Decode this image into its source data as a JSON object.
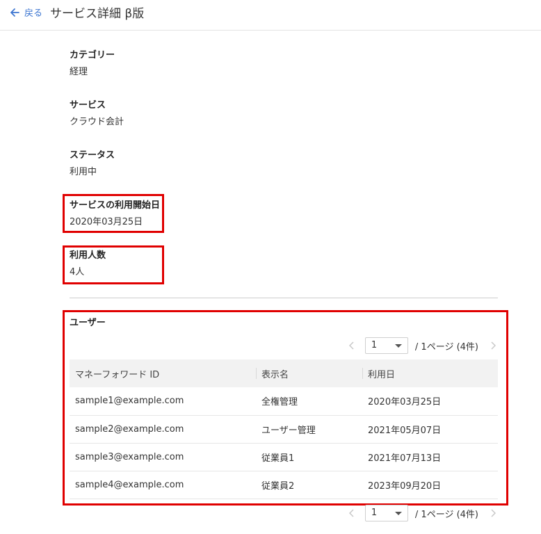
{
  "header": {
    "back_label": "戻る",
    "title": "サービス詳細 β版"
  },
  "fields": [
    {
      "label": "カテゴリー",
      "value": "経理"
    },
    {
      "label": "サービス",
      "value": "クラウド会計"
    },
    {
      "label": "ステータス",
      "value": "利用中"
    },
    {
      "label": "サービスの利用開始日",
      "value": "2020年03月25日"
    },
    {
      "label": "利用人数",
      "value": "4人"
    }
  ],
  "users_section": {
    "title": "ユーザー",
    "pager": {
      "current_page": "1",
      "summary": "/ 1ページ (4件)"
    },
    "columns": [
      "マネーフォワード ID",
      "表示名",
      "利用日"
    ],
    "rows": [
      [
        "sample1@example.com",
        "全権管理",
        "2020年03月25日"
      ],
      [
        "sample2@example.com",
        "ユーザー管理",
        "2021年05月07日"
      ],
      [
        "sample3@example.com",
        "従業員1",
        "2021年07月13日"
      ],
      [
        "sample4@example.com",
        "従業員2",
        "2023年09月20日"
      ]
    ]
  },
  "colors": {
    "accent": "#3d76d1",
    "highlight": "#e00000",
    "table_header_bg": "#f2f2f2"
  },
  "icons": {
    "back": "arrow-left-icon",
    "prev": "chevron-left-icon",
    "next": "chevron-right-icon",
    "dropdown": "caret-down-icon"
  }
}
